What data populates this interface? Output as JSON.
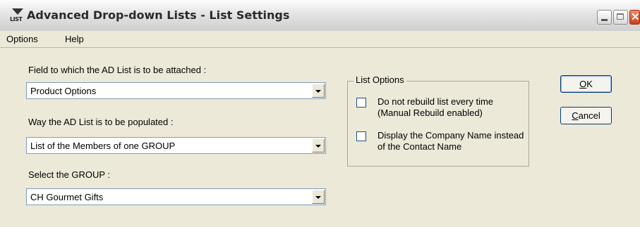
{
  "window": {
    "app_icon_text": "LIST",
    "title": "Advanced Drop-down Lists - List Settings"
  },
  "menu": {
    "items": [
      "Options",
      "Help"
    ]
  },
  "form": {
    "field_label": "Field to which the AD List is to be attached :",
    "field_value": "Product Options",
    "populate_label": "Way the AD List is to be populated :",
    "populate_value": "List of the Members of one GROUP",
    "group_label": "Select the GROUP :",
    "group_value": "CH Gourmet Gifts"
  },
  "list_options": {
    "title": "List Options",
    "rebuild_label": "Do not rebuild list every time (Manual Rebuild enabled)",
    "rebuild_checked": false,
    "company_label": "Display the Company Name instead of the Contact Name",
    "company_checked": false
  },
  "buttons": {
    "ok_first": "O",
    "ok_rest": "K",
    "cancel_first": "C",
    "cancel_rest": "ancel"
  }
}
